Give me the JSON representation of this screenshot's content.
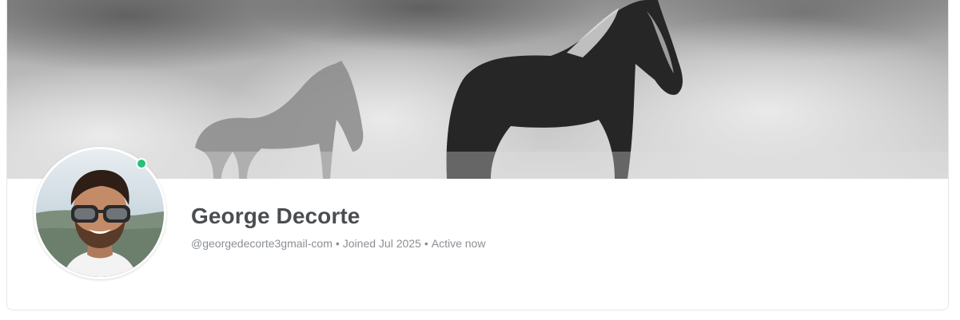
{
  "profile": {
    "name": "George Decorte",
    "handle": "@georgedecorte3gmail-com",
    "joined": "Joined Jul 2025",
    "status": "Active now",
    "separator": "•"
  },
  "cover": {
    "image": "cover-photo-horses"
  },
  "avatar": {
    "image": "profile-avatar-photo",
    "online": true
  },
  "colors": {
    "online_indicator": "#22c27a",
    "name_text": "#4a4e52",
    "meta_text": "#8b8f94",
    "card_border": "#e4e6e8"
  }
}
